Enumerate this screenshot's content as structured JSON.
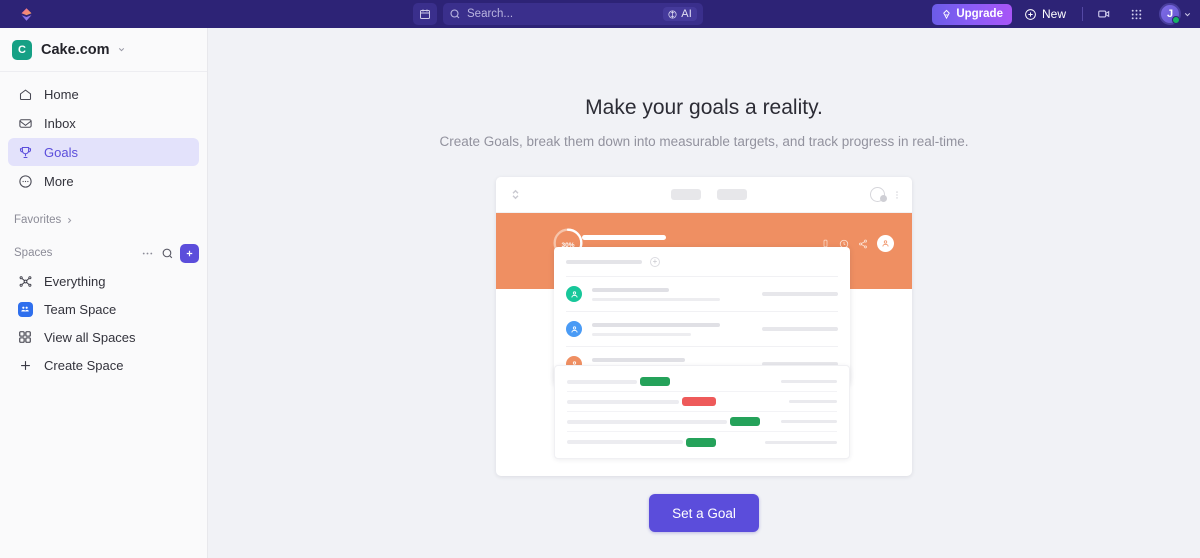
{
  "topbar": {
    "logo_icon": "cake-logo-icon",
    "calendar_icon": "calendar-icon",
    "search": {
      "icon": "search-icon",
      "placeholder": "Search...",
      "value": ""
    },
    "ai_chip": {
      "icon": "ai-sparkle-icon",
      "label": "AI"
    },
    "upgrade": {
      "icon": "rocket-icon",
      "label": "Upgrade"
    },
    "new": {
      "icon": "plus-circle-icon",
      "label": "New"
    },
    "video_icon": "video-camera-icon",
    "apps_icon": "apps-grid-icon",
    "avatar": {
      "initial": "J",
      "status": "online",
      "chevron_icon": "chevron-down-icon"
    },
    "colors": {
      "bar_bg": "#2d2376",
      "field_bg": "#3a2f8c",
      "upgrade_from": "#6b5ce7",
      "upgrade_to": "#a855f7",
      "status_dot": "#16b364"
    }
  },
  "sidebar": {
    "workspace": {
      "badge_letter": "C",
      "badge_color": "#16a085",
      "name": "Cake.com",
      "chevron_icon": "chevron-down-icon"
    },
    "nav": [
      {
        "label": "Home",
        "icon": "home-icon",
        "active": false
      },
      {
        "label": "Inbox",
        "icon": "inbox-icon",
        "active": false
      },
      {
        "label": "Goals",
        "icon": "trophy-icon",
        "active": true
      },
      {
        "label": "More",
        "icon": "more-dots-circle-icon",
        "active": false
      }
    ],
    "favorites": {
      "label": "Favorites",
      "chevron_icon": "chevron-right-icon"
    },
    "spaces": {
      "label": "Spaces",
      "more_icon": "ellipsis-icon",
      "search_icon": "search-icon",
      "add_icon": "plus-icon",
      "add_color": "#5b4ddb",
      "items": [
        {
          "label": "Everything",
          "icon": "network-nodes-icon"
        },
        {
          "label": "Team Space",
          "icon": "people-square-icon"
        },
        {
          "label": "View all Spaces",
          "icon": "grid-squares-icon"
        },
        {
          "label": "Create Space",
          "icon": "plus-icon"
        }
      ]
    },
    "active_highlight_color": "#e3e2fb",
    "active_text_color": "#5b4ddb"
  },
  "main": {
    "headline": "Make your goals a reality.",
    "subline": "Create Goals, break them down into measurable targets, and track progress in real-time.",
    "cta": {
      "label": "Set a Goal",
      "color": "#5b4ddb"
    },
    "illustration": {
      "name": "goals-preview-illustration",
      "band_color": "#ef8f62",
      "progress": {
        "value": 30,
        "label": "30%"
      },
      "topbar_icons": [
        "collapse-expand-icon",
        "avatar-icon",
        "more-vertical-icon"
      ],
      "band_icons": [
        "battery-icon",
        "clock-icon",
        "share-icon",
        "avatar-icon"
      ],
      "list_rows": [
        {
          "avatar_color": "#17c79a",
          "avatar_icon": "person-icon"
        },
        {
          "avatar_color": "#4a9bf5",
          "avatar_icon": "person-icon"
        },
        {
          "avatar_color": "#ef8f62",
          "avatar_icon": "person-icon"
        }
      ],
      "bar_rows": [
        {
          "track_width": 70,
          "badge_width": 30,
          "badge_color": "#25a25a"
        },
        {
          "track_width": 112,
          "badge_width": 34,
          "badge_color": "#ee5a5a"
        },
        {
          "track_width": 160,
          "badge_width": 30,
          "badge_color": "#25a25a"
        },
        {
          "track_width": 116,
          "badge_width": 30,
          "badge_color": "#25a25a"
        }
      ]
    }
  }
}
